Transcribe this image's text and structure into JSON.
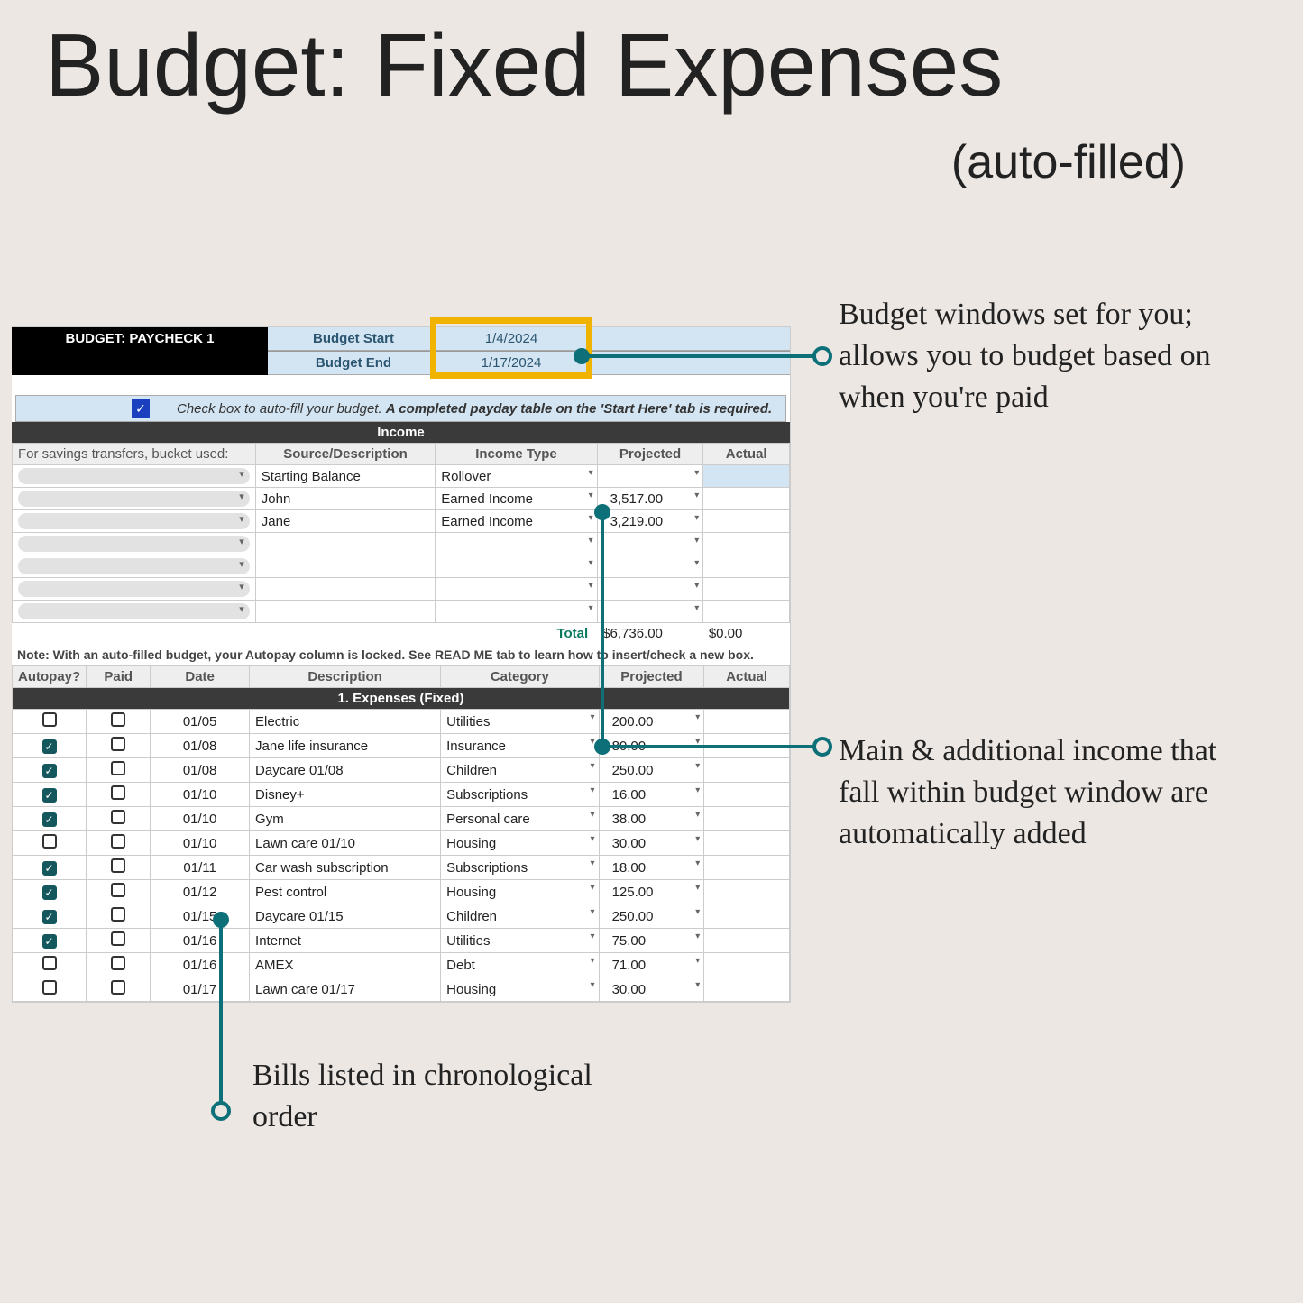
{
  "title": "Budget: Fixed Expenses",
  "subtitle": "(auto-filled)",
  "sheet": {
    "paycheck_label": "BUDGET: PAYCHECK 1",
    "budget_start_label": "Budget Start",
    "budget_start_value": "1/4/2024",
    "budget_end_label": "Budget End",
    "budget_end_value": "1/17/2024",
    "autofill_text_plain": "Check box to auto-fill your budget. ",
    "autofill_text_bold": "A completed payday table on the 'Start Here' tab is required.",
    "income_band": "Income",
    "income_headers": {
      "bucket": "For savings transfers, bucket used:",
      "source": "Source/Description",
      "type": "Income Type",
      "projected": "Projected",
      "actual": "Actual"
    },
    "income_rows": [
      {
        "source": "Starting Balance",
        "type": "Rollover",
        "projected": "",
        "highlight_actual": true
      },
      {
        "source": "John",
        "type": "Earned Income",
        "projected": "3,517.00"
      },
      {
        "source": "Jane",
        "type": "Earned Income",
        "projected": "3,219.00"
      },
      {
        "source": "",
        "type": "",
        "projected": ""
      },
      {
        "source": "",
        "type": "",
        "projected": ""
      },
      {
        "source": "",
        "type": "",
        "projected": ""
      },
      {
        "source": "",
        "type": "",
        "projected": ""
      }
    ],
    "income_total_label": "Total",
    "income_total_projected": "$6,736.00",
    "income_total_actual": "$0.00",
    "lock_note": "Note: With an auto-filled budget, your Autopay column is locked. See READ ME tab to learn how to insert/check a new box.",
    "expense_headers": {
      "autopay": "Autopay?",
      "paid": "Paid",
      "date": "Date",
      "description": "Description",
      "category": "Category",
      "projected": "Projected",
      "actual": "Actual"
    },
    "expenses_band": "1. Expenses (Fixed)",
    "expense_rows": [
      {
        "autopay": false,
        "paid": false,
        "date": "01/05",
        "description": "Electric",
        "category": "Utilities",
        "projected": "200.00"
      },
      {
        "autopay": true,
        "paid": false,
        "date": "01/08",
        "description": "Jane life insurance",
        "category": "Insurance",
        "projected": "80.00"
      },
      {
        "autopay": true,
        "paid": false,
        "date": "01/08",
        "description": "Daycare 01/08",
        "category": "Children",
        "projected": "250.00"
      },
      {
        "autopay": true,
        "paid": false,
        "date": "01/10",
        "description": "Disney+",
        "category": "Subscriptions",
        "projected": "16.00"
      },
      {
        "autopay": true,
        "paid": false,
        "date": "01/10",
        "description": "Gym",
        "category": "Personal care",
        "projected": "38.00"
      },
      {
        "autopay": false,
        "paid": false,
        "date": "01/10",
        "description": "Lawn care 01/10",
        "category": "Housing",
        "projected": "30.00"
      },
      {
        "autopay": true,
        "paid": false,
        "date": "01/11",
        "description": "Car wash subscription",
        "category": "Subscriptions",
        "projected": "18.00"
      },
      {
        "autopay": true,
        "paid": false,
        "date": "01/12",
        "description": "Pest control",
        "category": "Housing",
        "projected": "125.00"
      },
      {
        "autopay": true,
        "paid": false,
        "date": "01/15",
        "description": "Daycare 01/15",
        "category": "Children",
        "projected": "250.00"
      },
      {
        "autopay": true,
        "paid": false,
        "date": "01/16",
        "description": "Internet",
        "category": "Utilities",
        "projected": "75.00"
      },
      {
        "autopay": false,
        "paid": false,
        "date": "01/16",
        "description": "AMEX",
        "category": "Debt",
        "projected": "71.00"
      },
      {
        "autopay": false,
        "paid": false,
        "date": "01/17",
        "description": "Lawn care 01/17",
        "category": "Housing",
        "projected": "30.00"
      }
    ]
  },
  "callouts": {
    "c1": "Budget windows set for you; allows you to budget based on when you're paid",
    "c2": "Main & additional income that fall within budget window are automatically added",
    "c3": "Bills listed in chronological order"
  },
  "colors": {
    "teal": "#0d7078",
    "yellow": "#f0b400"
  }
}
